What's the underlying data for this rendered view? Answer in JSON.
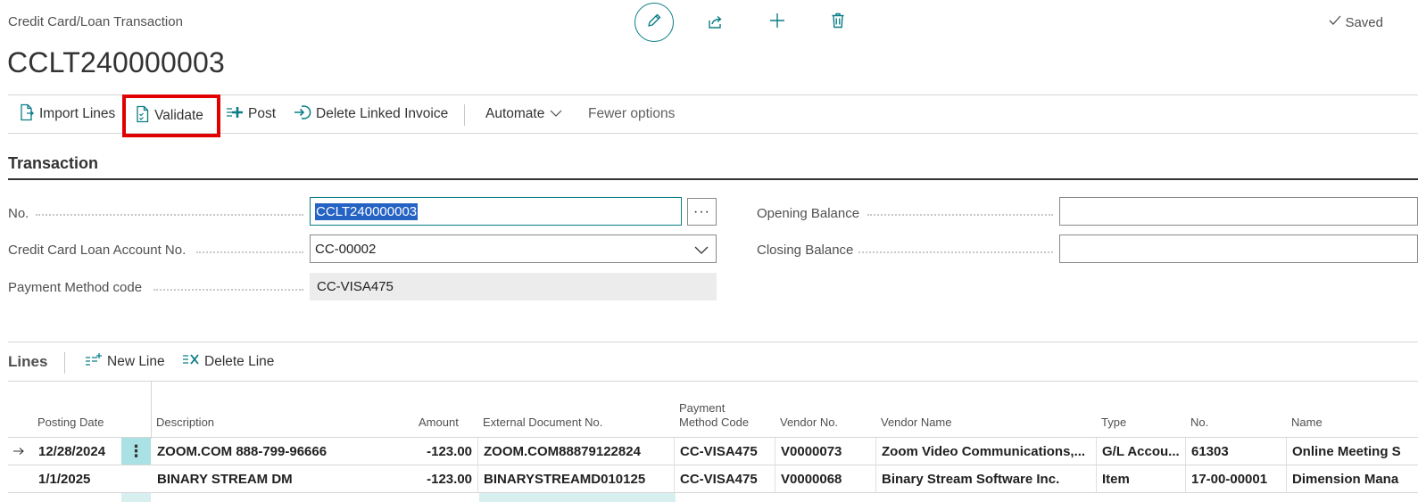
{
  "breadcrumb": "Credit Card/Loan Transaction",
  "document_title": "CCLT240000003",
  "status": {
    "saved_label": "Saved"
  },
  "top_icons": [
    "edit-icon",
    "share-icon",
    "plus-icon",
    "trash-icon"
  ],
  "actions": {
    "import_lines": "Import Lines",
    "validate": "Validate",
    "post": "Post",
    "delete_linked_invoice": "Delete Linked Invoice",
    "automate": "Automate",
    "fewer_options": "Fewer options"
  },
  "section": {
    "title": "Transaction"
  },
  "fields": {
    "no": {
      "label": "No.",
      "value": "CCLT240000003"
    },
    "account": {
      "label": "Credit Card Loan Account No.",
      "value": "CC-00002"
    },
    "payment_method": {
      "label": "Payment Method code",
      "value": "CC-VISA475"
    },
    "opening_balance": {
      "label": "Opening Balance",
      "value": ""
    },
    "closing_balance": {
      "label": "Closing Balance",
      "value": ""
    }
  },
  "lines": {
    "title": "Lines",
    "new_line": "New Line",
    "delete_line": "Delete Line",
    "columns": {
      "posting_date": "Posting Date",
      "description": "Description",
      "amount": "Amount",
      "external_doc": "External Document No.",
      "payment_method_1": "Payment",
      "payment_method_2": "Method Code",
      "vendor_no": "Vendor No.",
      "vendor_name": "Vendor Name",
      "type": "Type",
      "no": "No.",
      "name": "Name"
    },
    "rows": [
      {
        "posting_date": "12/28/2024",
        "description": "ZOOM.COM 888-799-96666",
        "amount": "-123.00",
        "external_doc": "ZOOM.COM88879122824",
        "payment_method": "CC-VISA475",
        "vendor_no": "V0000073",
        "vendor_name": "Zoom Video Communications,...",
        "type": "G/L Accou...",
        "no": "61303",
        "name": "Online Meeting S"
      },
      {
        "posting_date": "1/1/2025",
        "description": "BINARY STREAM DM",
        "amount": "-123.00",
        "external_doc": "BINARYSTREAMD010125",
        "payment_method": "CC-VISA475",
        "vendor_no": "V0000068",
        "vendor_name": "Binary Stream Software Inc.",
        "type": "Item",
        "no": "17-00-00001",
        "name": "Dimension Mana"
      }
    ]
  },
  "colors": {
    "accent": "#0a7d86",
    "highlight_border": "#e00000",
    "selection": "#2462c4",
    "row_action": "#a9e1e4"
  }
}
